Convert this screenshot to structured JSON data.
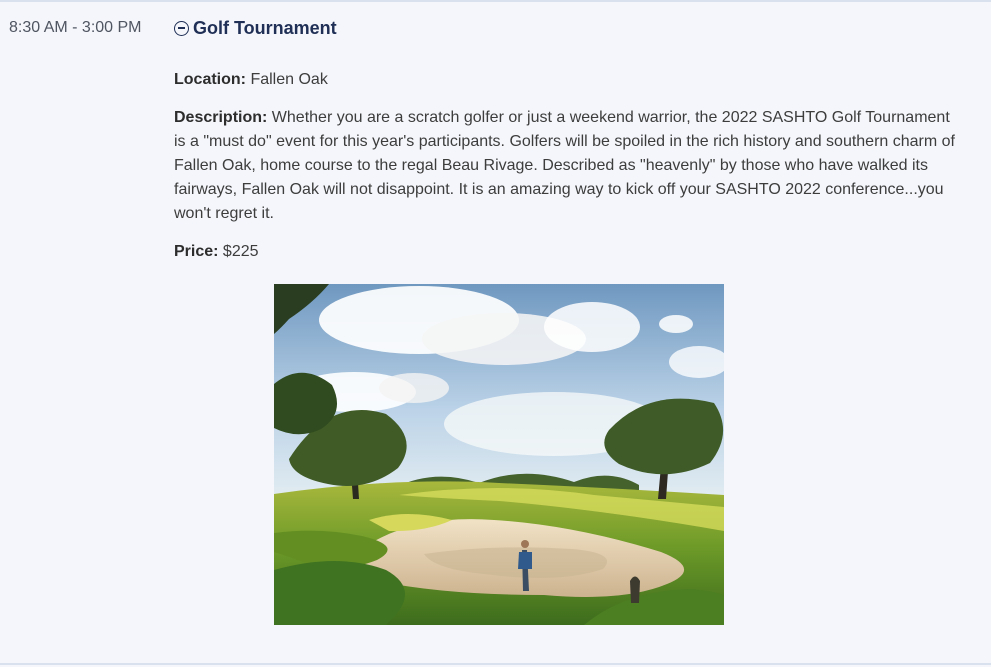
{
  "event": {
    "time": "8:30 AM - 3:00 PM",
    "title": "Golf Tournament",
    "location_label": "Location:",
    "location": "Fallen Oak",
    "description_label": "Description:",
    "description": "Whether you are a scratch golfer or just a weekend warrior, the 2022 SASHTO Golf Tournament is a \"must do\" event for this year's participants. Golfers will be spoiled in the rich history and southern charm of Fallen Oak, home course to the regal Beau Rivage. Described as \"heavenly\" by those who have walked its fairways, Fallen Oak will not disappoint. It is an amazing way to kick off your SASHTO 2022 conference...you won't regret it.",
    "price_label": "Price:",
    "price": "$225"
  },
  "icons": {
    "collapse": "minus-circle-icon"
  },
  "colors": {
    "background": "#f4f6fb",
    "title": "#1f2f55",
    "border": "#d9e1ee"
  }
}
